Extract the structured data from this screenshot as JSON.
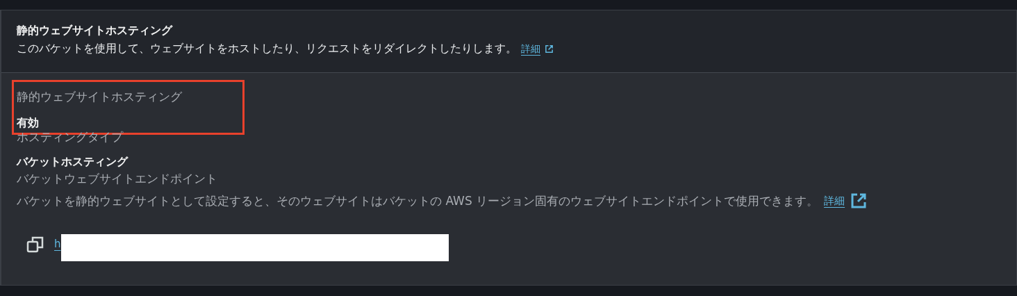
{
  "header": {
    "title": "静的ウェブサイトホスティング",
    "description": "このバケットを使用して、ウェブサイトをホストしたり、リクエストをリダイレクトしたりします。",
    "link": "詳細"
  },
  "fields": [
    {
      "label": "静的ウェブサイトホスティング",
      "value": "有効",
      "highlighted": true
    },
    {
      "label": "ホスティングタイプ",
      "value": "バケットホスティング",
      "highlighted": false
    }
  ],
  "endpoint": {
    "label": "バケットウェブサイトエンドポイント",
    "description": "バケットを静的ウェブサイトとして設定すると、そのウェブサイトはバケットの AWS リージョン固有のウェブサイトエンドポイントで使用できます。",
    "link": "詳細",
    "url": "h",
    "redacted": true
  }
}
